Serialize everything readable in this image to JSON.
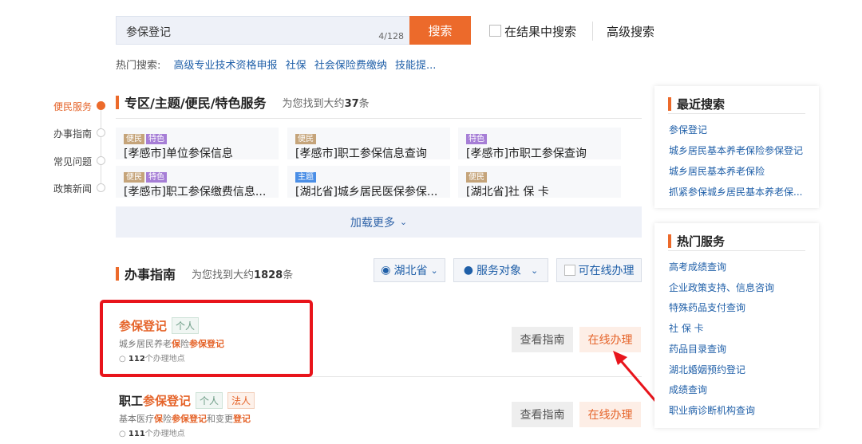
{
  "search": {
    "query": "参保登记",
    "count": "4/128",
    "button": "搜索",
    "in_results": "在结果中搜索",
    "advanced": "高级搜索"
  },
  "hot": {
    "label": "热门搜索:",
    "links": [
      "高级专业技术资格申报",
      "社保",
      "社会保险费缴纳",
      "技能提..."
    ]
  },
  "nav": [
    "便民服务",
    "办事指南",
    "常见问题",
    "政策新闻"
  ],
  "special": {
    "title": "专区/主题/便民/特色服务",
    "found_pre": "为您找到大约",
    "found_num": "37",
    "found_post": "条",
    "cards": [
      {
        "tags": [
          "便民",
          "特色"
        ],
        "title": "[孝感市]单位参保信息"
      },
      {
        "tags": [
          "便民"
        ],
        "title": "[孝感市]职工参保信息查询"
      },
      {
        "tags": [
          "特色"
        ],
        "title": "[孝感市]市职工参保查询"
      },
      {
        "tags": [
          "便民",
          "特色"
        ],
        "title": "[孝感市]职工参保缴费信息..."
      },
      {
        "tags": [
          "主题"
        ],
        "title": "[湖北省]城乡居民医保参保..."
      },
      {
        "tags": [
          "便民"
        ],
        "title": "[湖北省]社 保 卡"
      }
    ],
    "load_more": "加载更多"
  },
  "guide": {
    "title": "办事指南",
    "found_pre": "为您找到大约",
    "found_num": "1828",
    "found_post": "条",
    "filter_region": "湖北省",
    "filter_target": "服务对象",
    "filter_online": "可在线办理",
    "items": [
      {
        "title_pre": "",
        "title_hl": "参保登记",
        "tags": [
          "个人"
        ],
        "desc": [
          "城乡居民养老",
          "保",
          "险",
          "参保登记"
        ],
        "loc_num": "112",
        "loc_text": "个办理地点"
      },
      {
        "title_pre": "职工",
        "title_hl": "参保登记",
        "tags": [
          "个人",
          "法人"
        ],
        "desc": [
          "基本医疗",
          "保",
          "险",
          "参保登记",
          "和变更",
          "登记"
        ],
        "loc_num": "111",
        "loc_text": "个办理地点"
      }
    ],
    "btn_guide": "查看指南",
    "btn_online": "在线办理"
  },
  "recent": {
    "title": "最近搜索",
    "links": [
      "参保登记",
      "城乡居民基本养老保险参保登记",
      "城乡居民基本养老保险",
      "抓紧参保城乡居民基本养老保..."
    ]
  },
  "hot_service": {
    "title": "热门服务",
    "links": [
      "高考成绩查询",
      "企业政策支持、信息咨询",
      "特殊药品支付查询",
      "社 保 卡",
      "药品目录查询",
      "湖北婚姻预约登记",
      "成绩查询",
      "职业病诊断机构查询"
    ]
  },
  "colors": {
    "accent": "#ec6a2b",
    "link": "#1f5fa8",
    "annotation": "#e8141b"
  }
}
